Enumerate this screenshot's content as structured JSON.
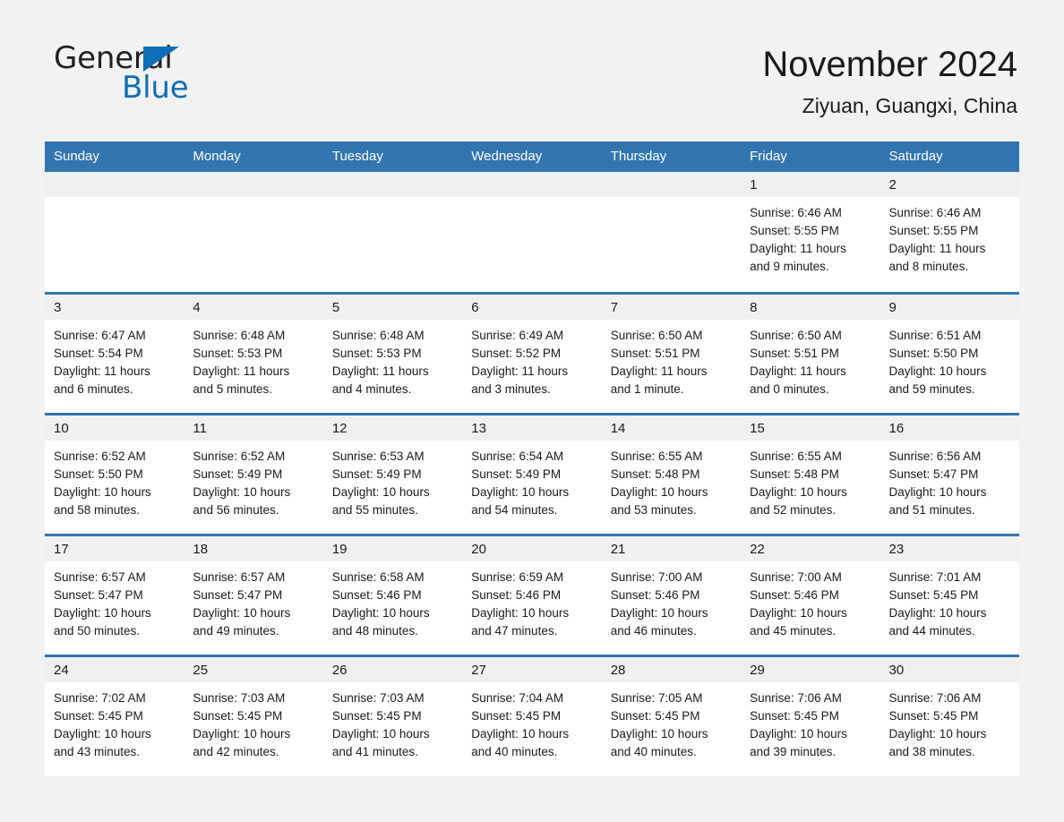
{
  "brand": {
    "name_part1": "General",
    "name_part2": "Blue",
    "triangle_color": "#0d6fb8"
  },
  "header": {
    "month_title": "November 2024",
    "location": "Ziyuan, Guangxi, China"
  },
  "colors": {
    "header_blue": "#3275b1",
    "daynum_strip": "#f0f0f0",
    "page_background": "#f2f2f2",
    "cell_background": "#ffffff",
    "text": "#1a1a1a"
  },
  "calendar": {
    "weekday_headers": [
      "Sunday",
      "Monday",
      "Tuesday",
      "Wednesday",
      "Thursday",
      "Friday",
      "Saturday"
    ],
    "weeks": [
      [
        {
          "day": "",
          "empty": true
        },
        {
          "day": "",
          "empty": true
        },
        {
          "day": "",
          "empty": true
        },
        {
          "day": "",
          "empty": true
        },
        {
          "day": "",
          "empty": true
        },
        {
          "day": "1",
          "sunrise": "Sunrise: 6:46 AM",
          "sunset": "Sunset: 5:55 PM",
          "daylight_line1": "Daylight: 11 hours",
          "daylight_line2": "and 9 minutes."
        },
        {
          "day": "2",
          "sunrise": "Sunrise: 6:46 AM",
          "sunset": "Sunset: 5:55 PM",
          "daylight_line1": "Daylight: 11 hours",
          "daylight_line2": "and 8 minutes."
        }
      ],
      [
        {
          "day": "3",
          "sunrise": "Sunrise: 6:47 AM",
          "sunset": "Sunset: 5:54 PM",
          "daylight_line1": "Daylight: 11 hours",
          "daylight_line2": "and 6 minutes."
        },
        {
          "day": "4",
          "sunrise": "Sunrise: 6:48 AM",
          "sunset": "Sunset: 5:53 PM",
          "daylight_line1": "Daylight: 11 hours",
          "daylight_line2": "and 5 minutes."
        },
        {
          "day": "5",
          "sunrise": "Sunrise: 6:48 AM",
          "sunset": "Sunset: 5:53 PM",
          "daylight_line1": "Daylight: 11 hours",
          "daylight_line2": "and 4 minutes."
        },
        {
          "day": "6",
          "sunrise": "Sunrise: 6:49 AM",
          "sunset": "Sunset: 5:52 PM",
          "daylight_line1": "Daylight: 11 hours",
          "daylight_line2": "and 3 minutes."
        },
        {
          "day": "7",
          "sunrise": "Sunrise: 6:50 AM",
          "sunset": "Sunset: 5:51 PM",
          "daylight_line1": "Daylight: 11 hours",
          "daylight_line2": "and 1 minute."
        },
        {
          "day": "8",
          "sunrise": "Sunrise: 6:50 AM",
          "sunset": "Sunset: 5:51 PM",
          "daylight_line1": "Daylight: 11 hours",
          "daylight_line2": "and 0 minutes."
        },
        {
          "day": "9",
          "sunrise": "Sunrise: 6:51 AM",
          "sunset": "Sunset: 5:50 PM",
          "daylight_line1": "Daylight: 10 hours",
          "daylight_line2": "and 59 minutes."
        }
      ],
      [
        {
          "day": "10",
          "sunrise": "Sunrise: 6:52 AM",
          "sunset": "Sunset: 5:50 PM",
          "daylight_line1": "Daylight: 10 hours",
          "daylight_line2": "and 58 minutes."
        },
        {
          "day": "11",
          "sunrise": "Sunrise: 6:52 AM",
          "sunset": "Sunset: 5:49 PM",
          "daylight_line1": "Daylight: 10 hours",
          "daylight_line2": "and 56 minutes."
        },
        {
          "day": "12",
          "sunrise": "Sunrise: 6:53 AM",
          "sunset": "Sunset: 5:49 PM",
          "daylight_line1": "Daylight: 10 hours",
          "daylight_line2": "and 55 minutes."
        },
        {
          "day": "13",
          "sunrise": "Sunrise: 6:54 AM",
          "sunset": "Sunset: 5:49 PM",
          "daylight_line1": "Daylight: 10 hours",
          "daylight_line2": "and 54 minutes."
        },
        {
          "day": "14",
          "sunrise": "Sunrise: 6:55 AM",
          "sunset": "Sunset: 5:48 PM",
          "daylight_line1": "Daylight: 10 hours",
          "daylight_line2": "and 53 minutes."
        },
        {
          "day": "15",
          "sunrise": "Sunrise: 6:55 AM",
          "sunset": "Sunset: 5:48 PM",
          "daylight_line1": "Daylight: 10 hours",
          "daylight_line2": "and 52 minutes."
        },
        {
          "day": "16",
          "sunrise": "Sunrise: 6:56 AM",
          "sunset": "Sunset: 5:47 PM",
          "daylight_line1": "Daylight: 10 hours",
          "daylight_line2": "and 51 minutes."
        }
      ],
      [
        {
          "day": "17",
          "sunrise": "Sunrise: 6:57 AM",
          "sunset": "Sunset: 5:47 PM",
          "daylight_line1": "Daylight: 10 hours",
          "daylight_line2": "and 50 minutes."
        },
        {
          "day": "18",
          "sunrise": "Sunrise: 6:57 AM",
          "sunset": "Sunset: 5:47 PM",
          "daylight_line1": "Daylight: 10 hours",
          "daylight_line2": "and 49 minutes."
        },
        {
          "day": "19",
          "sunrise": "Sunrise: 6:58 AM",
          "sunset": "Sunset: 5:46 PM",
          "daylight_line1": "Daylight: 10 hours",
          "daylight_line2": "and 48 minutes."
        },
        {
          "day": "20",
          "sunrise": "Sunrise: 6:59 AM",
          "sunset": "Sunset: 5:46 PM",
          "daylight_line1": "Daylight: 10 hours",
          "daylight_line2": "and 47 minutes."
        },
        {
          "day": "21",
          "sunrise": "Sunrise: 7:00 AM",
          "sunset": "Sunset: 5:46 PM",
          "daylight_line1": "Daylight: 10 hours",
          "daylight_line2": "and 46 minutes."
        },
        {
          "day": "22",
          "sunrise": "Sunrise: 7:00 AM",
          "sunset": "Sunset: 5:46 PM",
          "daylight_line1": "Daylight: 10 hours",
          "daylight_line2": "and 45 minutes."
        },
        {
          "day": "23",
          "sunrise": "Sunrise: 7:01 AM",
          "sunset": "Sunset: 5:45 PM",
          "daylight_line1": "Daylight: 10 hours",
          "daylight_line2": "and 44 minutes."
        }
      ],
      [
        {
          "day": "24",
          "sunrise": "Sunrise: 7:02 AM",
          "sunset": "Sunset: 5:45 PM",
          "daylight_line1": "Daylight: 10 hours",
          "daylight_line2": "and 43 minutes."
        },
        {
          "day": "25",
          "sunrise": "Sunrise: 7:03 AM",
          "sunset": "Sunset: 5:45 PM",
          "daylight_line1": "Daylight: 10 hours",
          "daylight_line2": "and 42 minutes."
        },
        {
          "day": "26",
          "sunrise": "Sunrise: 7:03 AM",
          "sunset": "Sunset: 5:45 PM",
          "daylight_line1": "Daylight: 10 hours",
          "daylight_line2": "and 41 minutes."
        },
        {
          "day": "27",
          "sunrise": "Sunrise: 7:04 AM",
          "sunset": "Sunset: 5:45 PM",
          "daylight_line1": "Daylight: 10 hours",
          "daylight_line2": "and 40 minutes."
        },
        {
          "day": "28",
          "sunrise": "Sunrise: 7:05 AM",
          "sunset": "Sunset: 5:45 PM",
          "daylight_line1": "Daylight: 10 hours",
          "daylight_line2": "and 40 minutes."
        },
        {
          "day": "29",
          "sunrise": "Sunrise: 7:06 AM",
          "sunset": "Sunset: 5:45 PM",
          "daylight_line1": "Daylight: 10 hours",
          "daylight_line2": "and 39 minutes."
        },
        {
          "day": "30",
          "sunrise": "Sunrise: 7:06 AM",
          "sunset": "Sunset: 5:45 PM",
          "daylight_line1": "Daylight: 10 hours",
          "daylight_line2": "and 38 minutes."
        }
      ]
    ]
  }
}
